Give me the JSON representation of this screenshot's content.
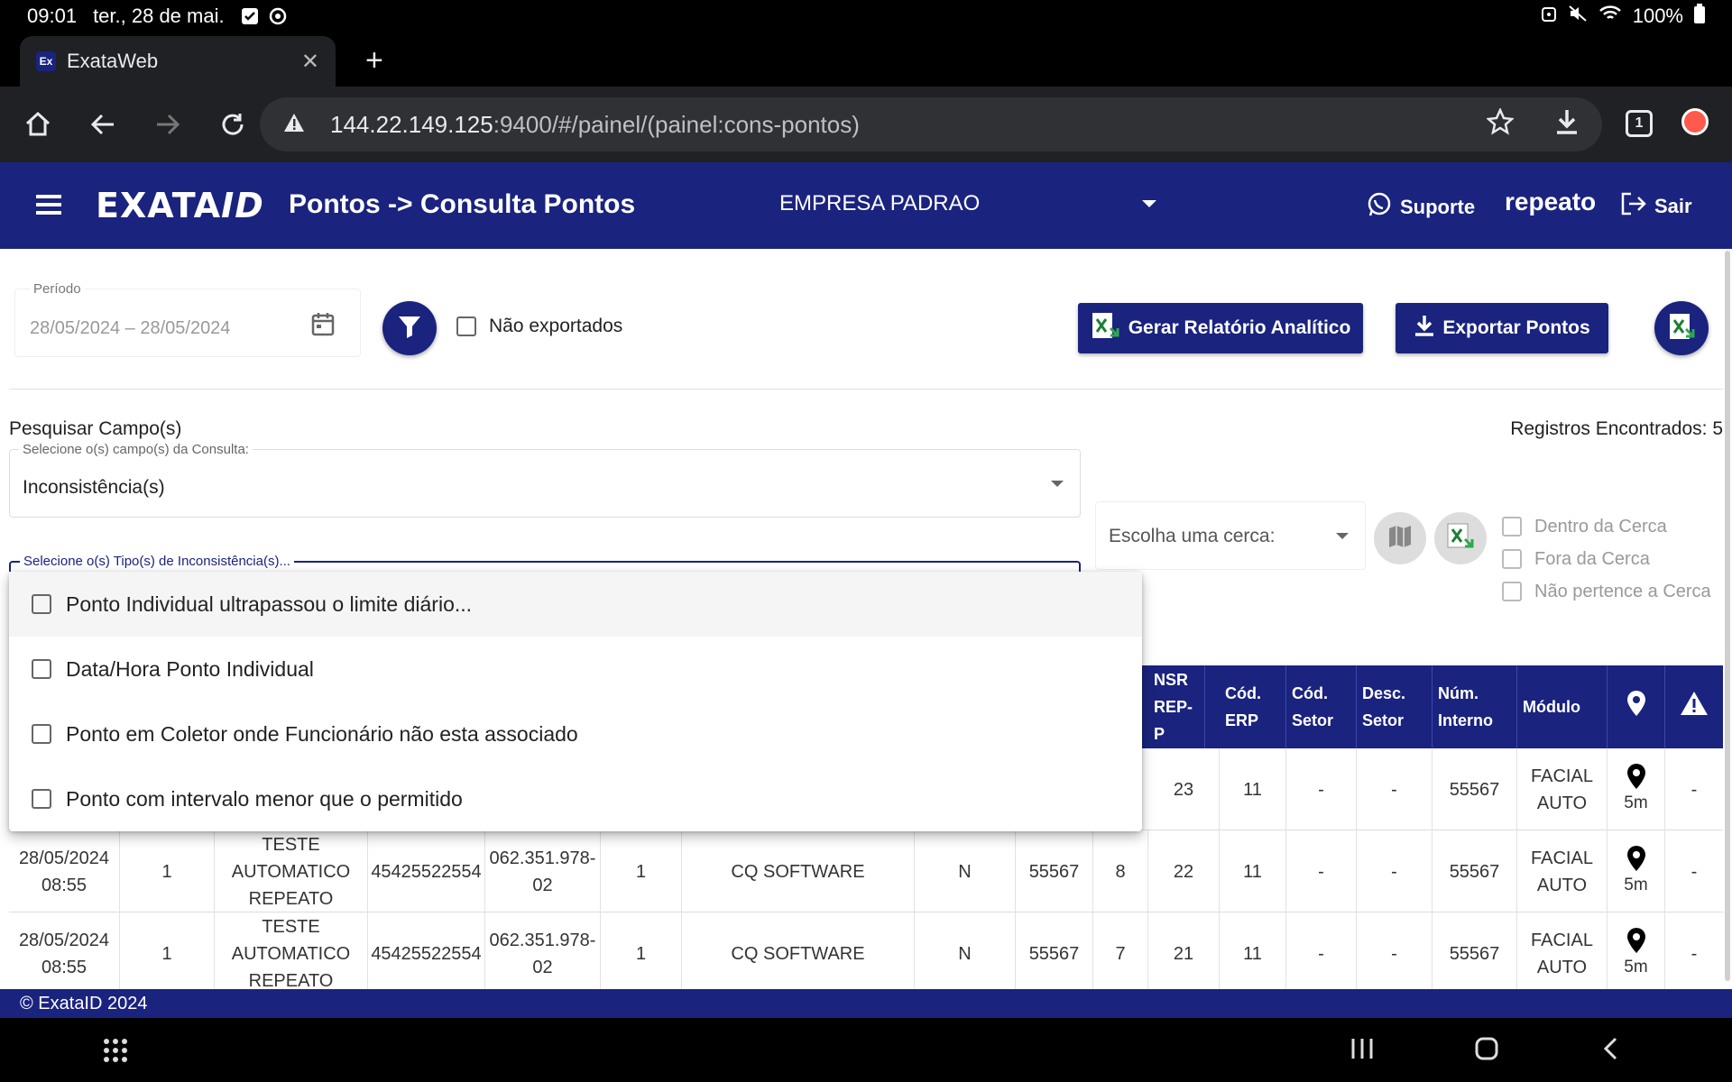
{
  "status_bar": {
    "time": "09:01",
    "date": "ter., 28 de mai.",
    "battery": "100%"
  },
  "browser": {
    "tab_title": "ExataWeb",
    "tab_favicon": "Ex",
    "url_host": "144.22.149.125",
    "url_path": ":9400/#/painel/(painel:cons-pontos)",
    "tab_count": "1"
  },
  "header": {
    "logo_main": "EXATA",
    "logo_suffix": "ID",
    "title": "Pontos -> Consulta Pontos",
    "company": "EMPRESA PADRAO",
    "support": "Suporte",
    "user": "repeato",
    "logout": "Sair"
  },
  "filters": {
    "period_label": "Período",
    "period_value": "28/05/2024 – 28/05/2024",
    "not_exported": "Não exportados",
    "btn_report": "Gerar Relatório Analítico",
    "btn_export": "Exportar Pontos"
  },
  "search": {
    "label": "Pesquisar Campo(s)",
    "records": "Registros Encontrados: 5",
    "fields_label": "Selecione o(s) campo(s) da Consulta:",
    "fields_value": "Inconsistência(s)",
    "types_label": "Selecione o(s) Tipo(s) de Inconsistência(s)...",
    "fence_placeholder": "Escolha uma cerca:",
    "fence_options": [
      "Dentro da Cerca",
      "Fora da Cerca",
      "Não pertence a Cerca"
    ]
  },
  "dropdown_options": [
    "Ponto Individual ultrapassou o limite diário...",
    "Data/Hora Ponto Individual",
    "Ponto em Coletor onde Funcionário não esta associado",
    "Ponto com intervalo menor que o permitido"
  ],
  "table": {
    "headers": {
      "nsr": "NSR REP-P",
      "cod_erp": "Cód. ERP",
      "cod_setor": "Cód. Setor",
      "desc_setor": "Desc. Setor",
      "num_interno": "Núm. Interno",
      "modulo": "Módulo"
    },
    "rows": [
      {
        "datetime": "",
        "c1": "",
        "name": "",
        "pis": "",
        "cpf": "",
        "c2": "",
        "company": "",
        "flag": "",
        "c3": "",
        "c4": "",
        "nsr": "23",
        "erp": "11",
        "cod_setor": "-",
        "desc_setor": "-",
        "interno": "55567",
        "modulo": "FACIAL AUTO",
        "dist": "5m",
        "warn": "-"
      },
      {
        "datetime": "28/05/2024 08:55",
        "c1": "1",
        "name": "TESTE AUTOMATICO REPEATO",
        "pis": "45425522554",
        "cpf": "062.351.978-02",
        "c2": "1",
        "company": "CQ SOFTWARE",
        "flag": "N",
        "c3": "55567",
        "c4": "8",
        "nsr": "22",
        "erp": "11",
        "cod_setor": "-",
        "desc_setor": "-",
        "interno": "55567",
        "modulo": "FACIAL AUTO",
        "dist": "5m",
        "warn": "-"
      },
      {
        "datetime": "28/05/2024 08:55",
        "c1": "1",
        "name": "TESTE AUTOMATICO REPEATO",
        "pis": "45425522554",
        "cpf": "062.351.978-02",
        "c2": "1",
        "company": "CQ SOFTWARE",
        "flag": "N",
        "c3": "55567",
        "c4": "7",
        "nsr": "21",
        "erp": "11",
        "cod_setor": "-",
        "desc_setor": "-",
        "interno": "55567",
        "modulo": "FACIAL AUTO",
        "dist": "5m",
        "warn": "-"
      }
    ]
  },
  "footer": {
    "text": "© ExataID 2024"
  },
  "colors": {
    "brand": "#1a237e",
    "excel_green": "#1e7e34"
  }
}
